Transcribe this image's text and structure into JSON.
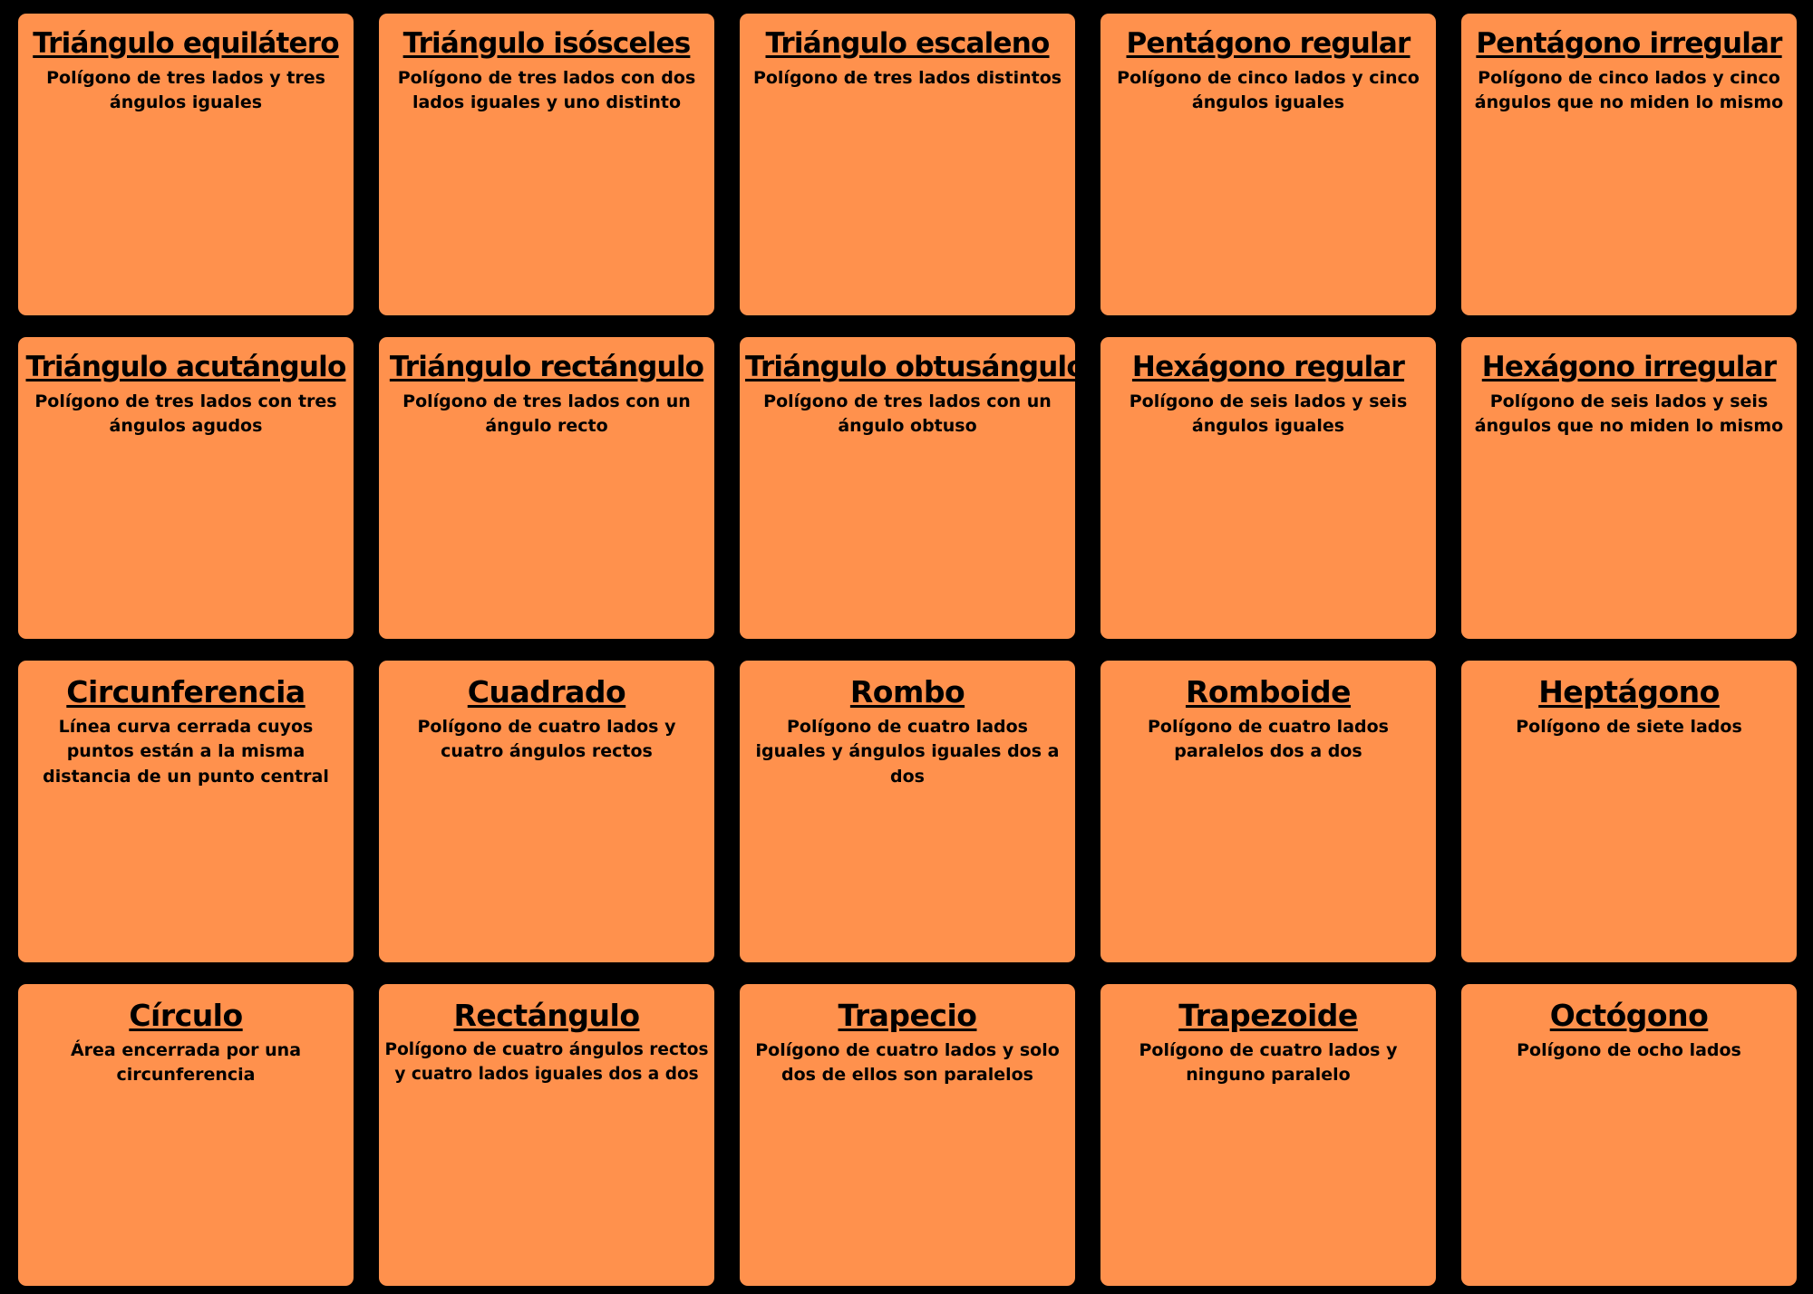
{
  "board": {
    "background_color": "#000000",
    "card_color": "#ff914d",
    "cards": [
      {
        "title": "Triángulo equilátero",
        "description": "Polígono de tres lados y tres ángulos iguales"
      },
      {
        "title": "Triángulo isósceles",
        "description": "Polígono de tres lados con dos lados iguales y uno distinto"
      },
      {
        "title": "Triángulo escaleno",
        "description": "Polígono de tres lados distintos"
      },
      {
        "title": "Pentágono regular",
        "description": "Polígono de cinco lados y cinco ángulos iguales"
      },
      {
        "title": "Pentágono irregular",
        "description": "Polígono de cinco lados y cinco ángulos que no miden lo mismo"
      },
      {
        "title": "Triángulo acutángulo",
        "description": "Polígono de tres lados con tres ángulos agudos"
      },
      {
        "title": "Triángulo rectángulo",
        "description": "Polígono de tres lados con un ángulo recto"
      },
      {
        "title": "Triángulo obtusángulo",
        "description": "Polígono de tres lados con un ángulo obtuso"
      },
      {
        "title": "Hexágono regular",
        "description": "Polígono de seis lados y seis ángulos iguales"
      },
      {
        "title": "Hexágono irregular",
        "description": "Polígono de seis lados y seis ángulos que no miden lo mismo"
      },
      {
        "title": "Circunferencia",
        "description": "Línea curva cerrada cuyos puntos están a la misma distancia de un punto central"
      },
      {
        "title": "Cuadrado",
        "description": "Polígono de cuatro lados y cuatro ángulos rectos"
      },
      {
        "title": "Rombo",
        "description": "Polígono de cuatro lados iguales y ángulos iguales dos a dos"
      },
      {
        "title": "Romboide",
        "description": "Polígono de cuatro lados paralelos dos a dos"
      },
      {
        "title": "Heptágono",
        "description": "Polígono de siete lados"
      },
      {
        "title": "Círculo",
        "description": "Área encerrada por una circunferencia"
      },
      {
        "title": "Rectángulo",
        "description": "Polígono de cuatro ángulos rectos y cuatro lados iguales dos a dos"
      },
      {
        "title": "Trapecio",
        "description": "Polígono de cuatro lados y solo dos de ellos son paralelos"
      },
      {
        "title": "Trapezoide",
        "description": "Polígono de cuatro lados y ninguno paralelo"
      },
      {
        "title": "Octógono",
        "description": "Polígono de ocho lados"
      }
    ]
  }
}
